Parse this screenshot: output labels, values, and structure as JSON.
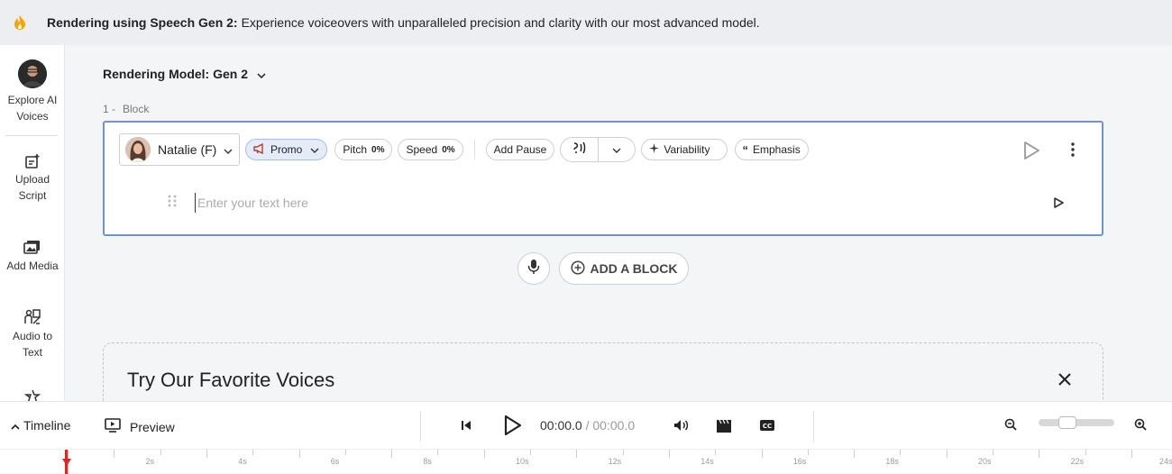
{
  "banner": {
    "bold": "Rendering using Speech Gen 2:",
    "text": "Experience voiceovers with unparalleled precision and clarity with our most advanced model.",
    "icon": "flame-icon",
    "icon_color": "#f2a50c"
  },
  "sidebar": {
    "items": [
      {
        "label_line1": "Explore AI",
        "label_line2": "Voices",
        "icon": "avatar"
      },
      {
        "label_line1": "Upload",
        "label_line2": "Script",
        "icon": "upload-script-icon"
      },
      {
        "label_line1": "Add Media",
        "label_line2": "",
        "icon": "add-media-icon"
      },
      {
        "label_line1": "Audio to",
        "label_line2": "Text",
        "icon": "audio-to-text-icon"
      }
    ]
  },
  "main": {
    "model_label": "Rendering Model: Gen 2",
    "block_index": "1 -",
    "block_name": "Block",
    "toolbar": {
      "voice": "Natalie (F)",
      "style": "Promo",
      "pitch_label": "Pitch",
      "pitch_value": "0%",
      "speed_label": "Speed",
      "speed_value": "0%",
      "add_pause": "Add Pause",
      "variability": "Variability",
      "emphasis": "Emphasis"
    },
    "editor_placeholder": "Enter your text here",
    "add_block": "ADD A BLOCK",
    "favorites_title": "Try Our Favorite Voices"
  },
  "bottom": {
    "timeline": "Timeline",
    "preview": "Preview",
    "current_time": "00:00.0",
    "separator": "/",
    "total_time": "00:00.0",
    "zoom_level": 0.35
  },
  "ruler": {
    "labels": [
      "2s",
      "4s",
      "6s",
      "8s",
      "10s",
      "12s",
      "14s",
      "16s",
      "18s",
      "20s",
      "22s",
      "24s"
    ]
  },
  "colors": {
    "accent": "#6b93d6",
    "promo_bg": "#e4ecfa",
    "playhead": "#e02424"
  }
}
